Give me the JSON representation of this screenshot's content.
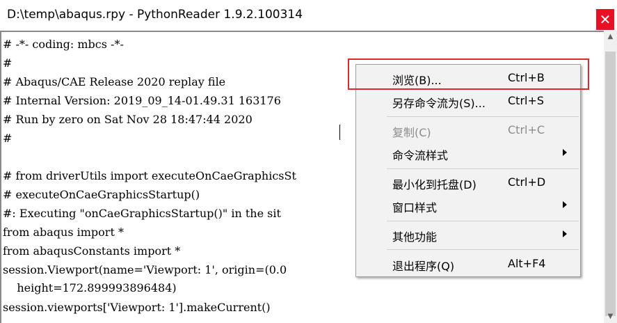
{
  "window": {
    "title": "D:\\temp\\abaqus.rpy - PythonReader 1.9.2.100314",
    "close_glyph": "✕"
  },
  "code_lines": [
    "# -*- coding: mbcs -*-",
    "#",
    "# Abaqus/CAE Release 2020 replay file",
    "# Internal Version: 2019_09_14-01.49.31 163176",
    "# Run by zero on Sat Nov 28 18:47:44 2020",
    "#",
    "",
    "# from driverUtils import executeOnCaeGraphicsSt",
    "# executeOnCaeGraphicsStartup()",
    "#: Executing \"onCaeGraphicsStartup()\" in the sit",
    "from abaqus import *",
    "from abaqusConstants import *",
    "session.Viewport(name='Viewport: 1', origin=(0.0",
    "    height=172.899993896484)",
    "session.viewports['Viewport: 1'].makeCurrent()"
  ],
  "context_menu": {
    "items": [
      {
        "label": "浏览(B)...",
        "shortcut": "Ctrl+B"
      },
      {
        "label": "另存命令流为(S)...",
        "shortcut": "Ctrl+S"
      },
      {
        "label": "复制(C)",
        "shortcut": "Ctrl+C"
      },
      {
        "label": "命令流样式",
        "shortcut": ""
      },
      {
        "label": "最小化到托盘(D)",
        "shortcut": "Ctrl+D"
      },
      {
        "label": "窗口样式",
        "shortcut": ""
      },
      {
        "label": "其他功能",
        "shortcut": ""
      },
      {
        "label": "退出程序(Q)",
        "shortcut": "Alt+F4"
      }
    ]
  },
  "colors": {
    "close_button": "#e81123",
    "highlight_box": "#e0282c",
    "menu_background": "#f2f2f2",
    "disabled_text": "#8c8c8c"
  },
  "icons": {
    "close": "close-icon",
    "submenu": "submenu-arrow-icon",
    "scroll_up": "scroll-up-icon",
    "scroll_down": "scroll-down-icon"
  }
}
